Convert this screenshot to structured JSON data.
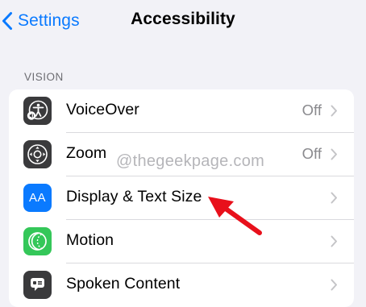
{
  "nav": {
    "back_label": "Settings",
    "title": "Accessibility"
  },
  "section": {
    "header": "VISION"
  },
  "rows": [
    {
      "label": "VoiceOver",
      "value": "Off",
      "icon": "voiceover-icon",
      "icon_color": "#3a3a3c"
    },
    {
      "label": "Zoom",
      "value": "Off",
      "icon": "zoom-icon",
      "icon_color": "#3a3a3c"
    },
    {
      "label": "Display & Text Size",
      "value": "",
      "icon": "display-text-size-icon",
      "icon_glyph": "AA",
      "icon_color": "#0a7aff"
    },
    {
      "label": "Motion",
      "value": "",
      "icon": "motion-icon",
      "icon_color": "#34c759"
    },
    {
      "label": "Spoken Content",
      "value": "",
      "icon": "spoken-content-icon",
      "icon_color": "#3a3a3c"
    }
  ],
  "watermark": "@thegeekpage.com",
  "annotation": {
    "color": "#e8101b"
  }
}
